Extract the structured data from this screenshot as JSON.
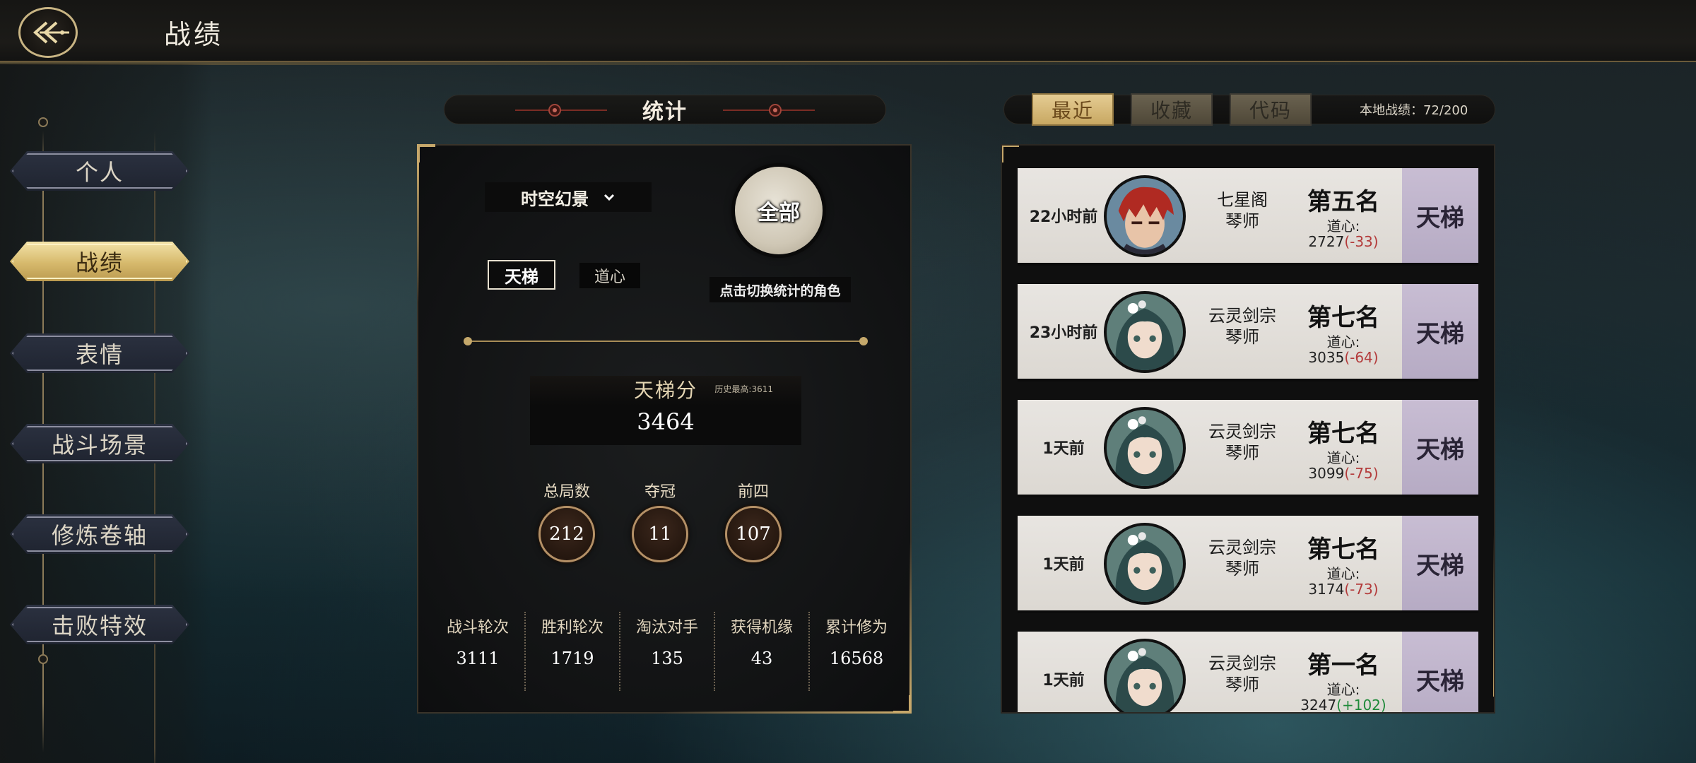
{
  "header": {
    "title": "战绩",
    "back_icon": "back-arrow-icon"
  },
  "sidebar": {
    "items": [
      {
        "label": "个人",
        "active": false
      },
      {
        "label": "战绩",
        "active": true
      },
      {
        "label": "表情",
        "active": false
      },
      {
        "label": "战斗场景",
        "active": false
      },
      {
        "label": "修炼卷轴",
        "active": false
      },
      {
        "label": "击败特效",
        "active": false
      }
    ]
  },
  "stats": {
    "title": "统计",
    "mode_select": "时空幻景",
    "all_button": "全部",
    "switch_hint": "点击切换统计的角色",
    "tabs": {
      "ladder": "天梯",
      "daoxin": "道心"
    },
    "ladder_label": "天梯分",
    "ladder_best": "历史最高:3611",
    "ladder_value": "3464",
    "circles": [
      {
        "label": "总局数",
        "value": "212"
      },
      {
        "label": "夺冠",
        "value": "11"
      },
      {
        "label": "前四",
        "value": "107"
      }
    ],
    "bottom": [
      {
        "label": "战斗轮次",
        "value": "3111"
      },
      {
        "label": "胜利轮次",
        "value": "1719"
      },
      {
        "label": "淘汰对手",
        "value": "135"
      },
      {
        "label": "获得机缘",
        "value": "43"
      },
      {
        "label": "累计修为",
        "value": "16568"
      }
    ]
  },
  "history": {
    "tabs": [
      "最近",
      "收藏",
      "代码"
    ],
    "local_count": "本地战绩：72/200",
    "matches": [
      {
        "time": "22小时前",
        "faction_line1": "七星阁",
        "faction_line2": "琴师",
        "rank": "第五名",
        "dao_label": "道心:",
        "dao_base": "2727",
        "dao_delta": "(-33)",
        "delta_sign": "neg",
        "mode": "天梯",
        "avatar": "red"
      },
      {
        "time": "23小时前",
        "faction_line1": "云灵剑宗",
        "faction_line2": "琴师",
        "rank": "第七名",
        "dao_label": "道心:",
        "dao_base": "3035",
        "dao_delta": "(-64)",
        "delta_sign": "neg",
        "mode": "天梯",
        "avatar": "teal"
      },
      {
        "time": "1天前",
        "faction_line1": "云灵剑宗",
        "faction_line2": "琴师",
        "rank": "第七名",
        "dao_label": "道心:",
        "dao_base": "3099",
        "dao_delta": "(-75)",
        "delta_sign": "neg",
        "mode": "天梯",
        "avatar": "teal"
      },
      {
        "time": "1天前",
        "faction_line1": "云灵剑宗",
        "faction_line2": "琴师",
        "rank": "第七名",
        "dao_label": "道心:",
        "dao_base": "3174",
        "dao_delta": "(-73)",
        "delta_sign": "neg",
        "mode": "天梯",
        "avatar": "teal"
      },
      {
        "time": "1天前",
        "faction_line1": "云灵剑宗",
        "faction_line2": "琴师",
        "rank": "第一名",
        "dao_label": "道心:",
        "dao_base": "3247",
        "dao_delta": "(+102)",
        "delta_sign": "pos",
        "mode": "天梯",
        "avatar": "teal"
      }
    ]
  }
}
